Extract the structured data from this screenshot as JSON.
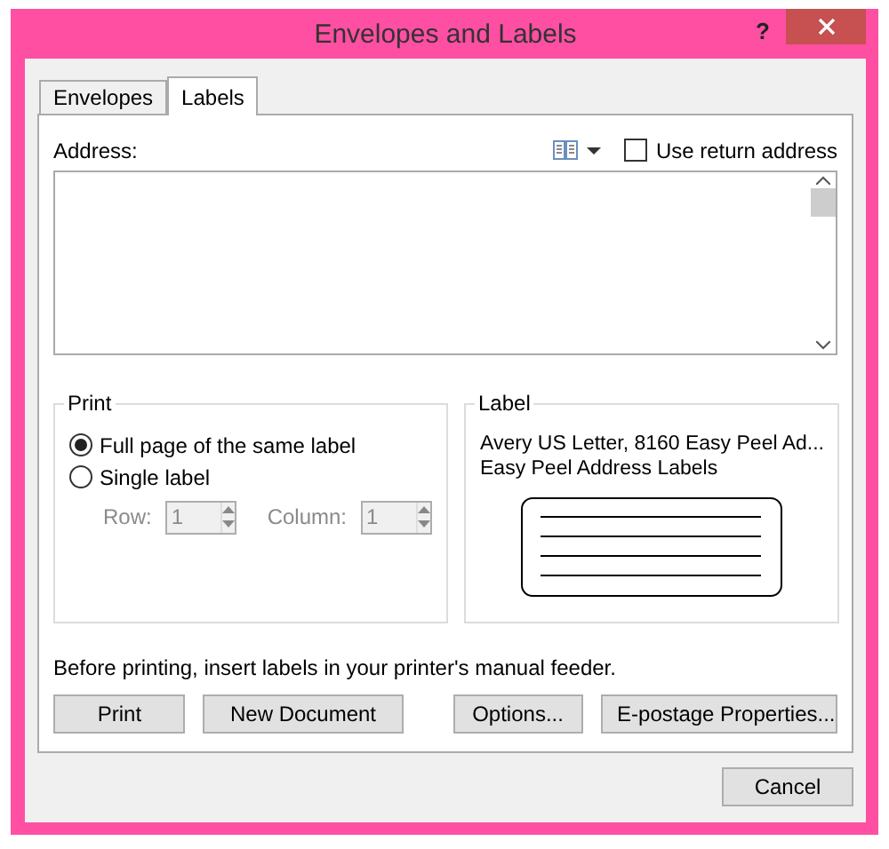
{
  "window": {
    "title": "Envelopes and Labels",
    "help": "?"
  },
  "tabs": [
    {
      "label": "Envelopes",
      "selected": false
    },
    {
      "label": "Labels",
      "selected": true
    }
  ],
  "address": {
    "label": "Address:",
    "return_address": {
      "label": "Use return address",
      "checked": false
    }
  },
  "print": {
    "title": "Print",
    "options": [
      {
        "label": "Full page of the same label",
        "selected": true
      },
      {
        "label": "Single label",
        "selected": false
      }
    ],
    "row": {
      "label": "Row:",
      "value": "1",
      "disabled": true
    },
    "column": {
      "label": "Column:",
      "value": "1",
      "disabled": true
    }
  },
  "label": {
    "title": "Label",
    "lines": [
      "Avery US Letter, 8160 Easy Peel Ad...",
      "Easy Peel Address Labels"
    ]
  },
  "note": "Before printing, insert labels in your printer's manual feeder.",
  "buttons": [
    "Print",
    "New Document",
    "Options...",
    "E-postage Properties..."
  ],
  "footer_buttons": [
    "Cancel"
  ]
}
